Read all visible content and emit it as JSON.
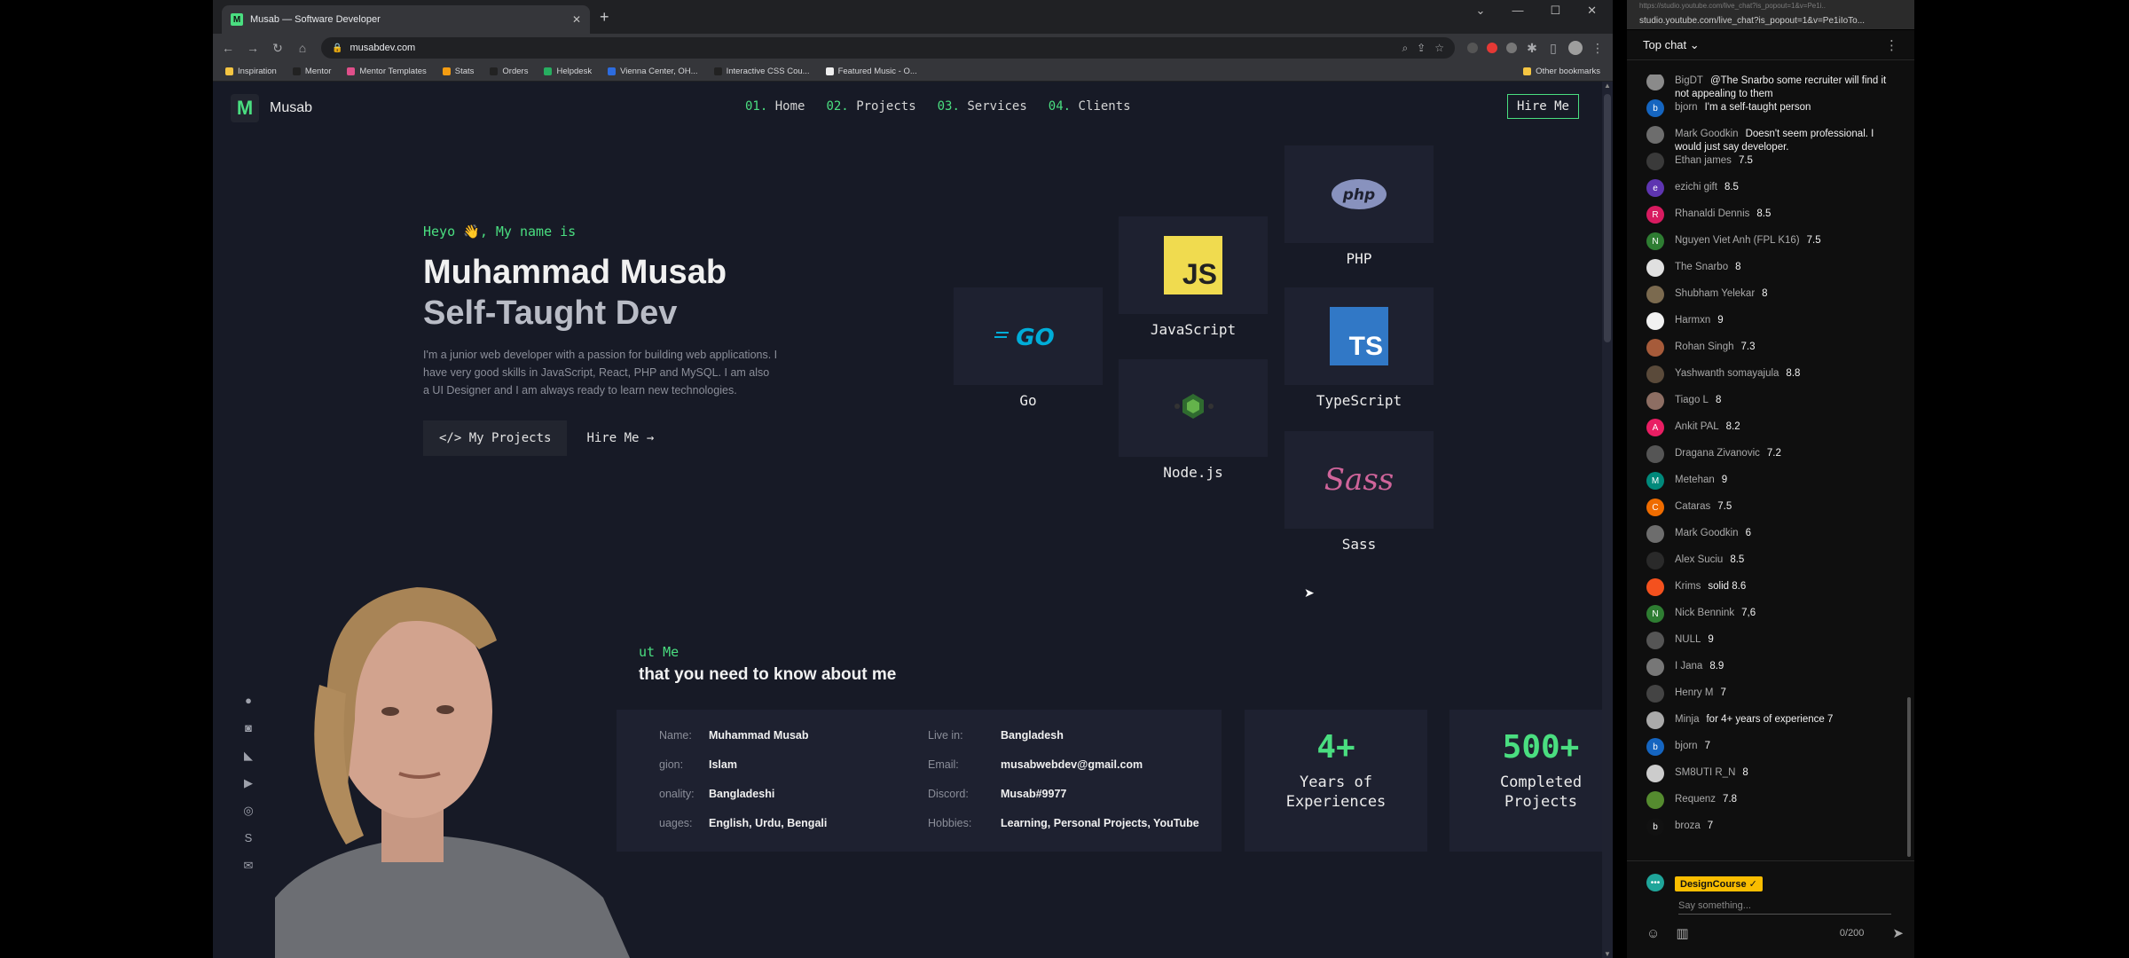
{
  "browser": {
    "tab_title": "Musab — Software Developer",
    "url": "musabdev.com",
    "bookmarks": [
      "Inspiration",
      "Mentor",
      "Mentor Templates",
      "Stats",
      "Orders",
      "Helpdesk",
      "Vienna Center, OH...",
      "Interactive CSS Cou...",
      "Featured Music - O..."
    ],
    "other_bookmarks": "Other bookmarks"
  },
  "site": {
    "logo_letter": "M",
    "logo_text": "Musab",
    "nav": [
      {
        "num": "01.",
        "label": "Home"
      },
      {
        "num": "02.",
        "label": "Projects"
      },
      {
        "num": "03.",
        "label": "Services"
      },
      {
        "num": "04.",
        "label": "Clients"
      }
    ],
    "hire_button": "Hire Me",
    "hero": {
      "greeting": "Heyo 👋, My name is",
      "name": "Muhammad Musab",
      "role": "Self-Taught Dev",
      "description": "I'm a junior web developer with a passion for building web applications. I have very good skills in JavaScript, React, PHP and MySQL. I am also a UI Designer and I am always ready to learn new technologies.",
      "btn_projects": "</> My Projects",
      "btn_hire": "Hire Me →"
    },
    "skills": {
      "php": "PHP",
      "javascript": "JavaScript",
      "go": "Go",
      "typescript": "TypeScript",
      "nodejs": "Node.js",
      "sass": "Sass",
      "js_logo": "JS",
      "ts_logo": "TS",
      "php_logo": "php",
      "go_logo": "GO",
      "sass_logo": "Sass"
    },
    "about": {
      "label": "ut Me",
      "title": "that you need to know about me",
      "info": {
        "name_key": "Name:",
        "name_val": "Muhammad Musab",
        "religion_key": "gion:",
        "religion_val": "Islam",
        "nationality_key": "onality:",
        "nationality_val": "Bangladeshi",
        "languages_key": "uages:",
        "languages_val": "English, Urdu, Bengali",
        "live_key": "Live in:",
        "live_val": "Bangladesh",
        "email_key": "Email:",
        "email_val": "musabwebdev@gmail.com",
        "discord_key": "Discord:",
        "discord_val": "Musab#9977",
        "hobbies_key": "Hobbies:",
        "hobbies_val": "Learning, Personal Projects, YouTube"
      },
      "stat1_num": "4+",
      "stat1_label_1": "Years of",
      "stat1_label_2": "Experiences",
      "stat2_num": "500+",
      "stat2_label_1": "Completed",
      "stat2_label_2": "Projects"
    }
  },
  "chat": {
    "popout_url": "https://studio.youtube.com/live_chat?is_popout=1&v=Pe1i..",
    "url": "studio.youtube.com/live_chat?is_popout=1&v=Pe1iIoTo...",
    "header": "Top chat",
    "messages": [
      {
        "author": "BigDT",
        "text": "@The Snarbo some recruiter will find it not appealing to them",
        "color": "#8a8a8a",
        "initial": ""
      },
      {
        "author": "bjorn",
        "text": "I'm a self-taught person",
        "color": "#1565c0",
        "initial": "b"
      },
      {
        "author": "Mark Goodkin",
        "text": "Doesn't seem professional. I would just say developer.",
        "color": "#6d6d6d",
        "initial": ""
      },
      {
        "author": "Ethan james",
        "text": "7.5",
        "color": "#3a3a3a",
        "initial": ""
      },
      {
        "author": "ezichi gift",
        "text": "8.5",
        "color": "#5e35b1",
        "initial": "e"
      },
      {
        "author": "Rhanaldi Dennis",
        "text": "8.5",
        "color": "#d81b60",
        "initial": "R"
      },
      {
        "author": "Nguyen Viet Anh (FPL K16)",
        "text": "7.5",
        "color": "#2e7d32",
        "initial": "N"
      },
      {
        "author": "The Snarbo",
        "text": "8",
        "color": "#e0e0e0",
        "initial": ""
      },
      {
        "author": "Shubham Yelekar",
        "text": "8",
        "color": "#7b6a4f",
        "initial": ""
      },
      {
        "author": "Harmxn",
        "text": "9",
        "color": "#f1f1f1",
        "initial": ""
      },
      {
        "author": "Rohan Singh",
        "text": "7.3",
        "color": "#a65b3a",
        "initial": ""
      },
      {
        "author": "Yashwanth somayajula",
        "text": "8.8",
        "color": "#5a4a3a",
        "initial": ""
      },
      {
        "author": "Tiago L",
        "text": "8",
        "color": "#8d6e63",
        "initial": ""
      },
      {
        "author": "Ankit PAL",
        "text": "8.2",
        "color": "#e91e63",
        "initial": "A"
      },
      {
        "author": "Dragana Zivanovic",
        "text": "7.2",
        "color": "#555",
        "initial": ""
      },
      {
        "author": "Metehan",
        "text": "9",
        "color": "#00897b",
        "initial": "M"
      },
      {
        "author": "Cataras",
        "text": "7.5",
        "color": "#ef6c00",
        "initial": "C"
      },
      {
        "author": "Mark Goodkin",
        "text": "6",
        "color": "#6d6d6d",
        "initial": ""
      },
      {
        "author": "Alex Suciu",
        "text": "8.5",
        "color": "#2a2a2a",
        "initial": ""
      },
      {
        "author": "Krims",
        "text": "solid 8.6",
        "color": "#f4511e",
        "initial": ""
      },
      {
        "author": "Nick Bennink",
        "text": "7,6",
        "color": "#2e7d32",
        "initial": "N"
      },
      {
        "author": "NULL",
        "text": "9",
        "color": "#555",
        "initial": ""
      },
      {
        "author": "I Jana",
        "text": "8.9",
        "color": "#777",
        "initial": ""
      },
      {
        "author": "Henry M",
        "text": "7",
        "color": "#444",
        "initial": ""
      },
      {
        "author": "Minja",
        "text": "for 4+ years of experience 7",
        "color": "#aaa",
        "initial": ""
      },
      {
        "author": "bjorn",
        "text": "7",
        "color": "#1565c0",
        "initial": "b"
      },
      {
        "author": "SM8UTI R_N",
        "text": "8",
        "color": "#ccc",
        "initial": ""
      },
      {
        "author": "Requenz",
        "text": "7.8",
        "color": "#558b2f",
        "initial": ""
      },
      {
        "author": "broza",
        "text": "7",
        "color": "#111",
        "initial": "b"
      }
    ],
    "footer_user": "DesignCourse ✓",
    "input_placeholder": "Say something...",
    "char_count": "0/200"
  }
}
